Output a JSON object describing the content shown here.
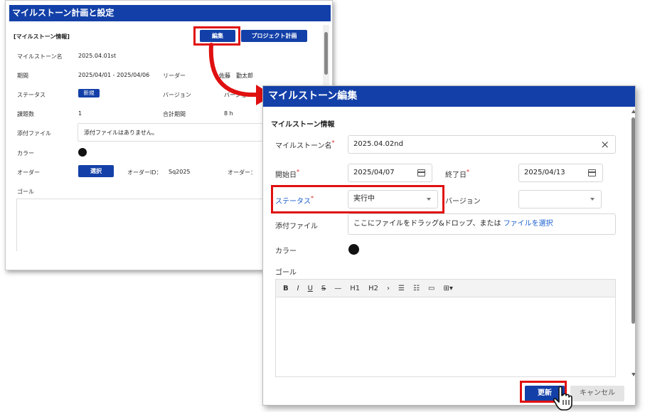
{
  "back_window": {
    "title": "マイルストーン計画と設定",
    "section_title": "[マイルストーン情報]",
    "edit_button": "編集",
    "project_plan_button": "プロジェクト計画",
    "name_label": "マイルストーン名",
    "name_value": "2025.04.01st",
    "period_label": "期間",
    "period_value": "2025/04/01 - 2025/04/06",
    "leader_label": "リーダー",
    "leader_value": "佐藤　勤太郎",
    "status_label": "ステータス",
    "status_value": "新規",
    "version_label": "バージョン",
    "version_value": "バージョン",
    "issues_label": "課題数",
    "issues_value": "1",
    "total_period_label": "合計期間",
    "total_period_value": "8 h",
    "attachment_label": "添付ファイル",
    "attachment_value": "添付ファイルはありません。",
    "color_label": "カラー",
    "color_value": "#111111",
    "order_label": "オーダー",
    "select_button": "選択",
    "order_id_label": "オーダーID：",
    "order_id_value": "Sq2025",
    "order_label_2": "オーダー：",
    "goal_label": "ゴール"
  },
  "dialog": {
    "title": "マイルストーン編集",
    "section_title": "マイルストーン情報",
    "name_label": "マイルストーン名",
    "name_value": "2025.04.02nd",
    "start_label": "開始日",
    "start_value": "2025/04/07",
    "end_label": "終了日",
    "end_value": "2025/04/13",
    "status_label": "ステータス",
    "status_value": "実行中",
    "version_label": "バージョン",
    "version_value": "",
    "attachment_label": "添付ファイル",
    "attachment_text": "ここにファイルをドラッグ&ドロップ、または",
    "attachment_link": "ファイルを選択",
    "color_label": "カラー",
    "color_value": "#111111",
    "goal_label": "ゴール",
    "toolbar": [
      "B",
      "I",
      "U",
      "S",
      "—",
      "H1",
      "H2",
      "›",
      "☰",
      "☷",
      "▭",
      "⊞▾"
    ],
    "update_button": "更新",
    "cancel_button": "キャンセル",
    "required_mark": "*",
    "clear_icon": "×"
  },
  "colors": {
    "brand": "#1340a8",
    "highlight": "#e01010",
    "link": "#1b5fcf"
  },
  "icons": [
    "calendar-icon",
    "chevron-down-icon",
    "close-icon",
    "pointer-hand-icon",
    "arrow-icon"
  ]
}
